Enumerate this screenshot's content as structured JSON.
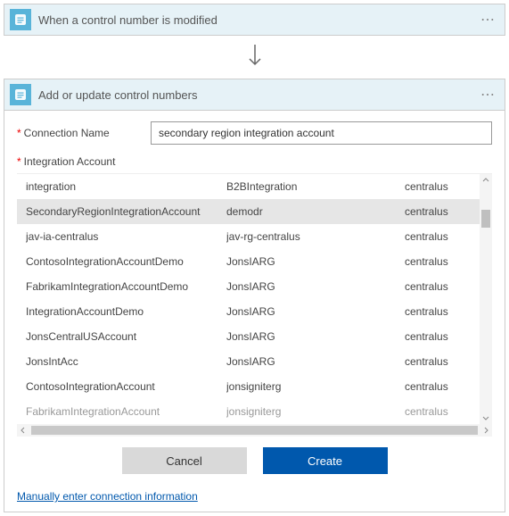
{
  "trigger": {
    "title": "When a control number is modified"
  },
  "action": {
    "title": "Add or update control numbers",
    "form": {
      "connection_name_label": "Connection Name",
      "connection_name_value": "secondary region integration account",
      "integration_account_label": "Integration Account"
    },
    "accounts": [
      {
        "name": "integration",
        "group": "B2BIntegration",
        "region": "centralus",
        "selected": false
      },
      {
        "name": "SecondaryRegionIntegrationAccount",
        "group": "demodr",
        "region": "centralus",
        "selected": true
      },
      {
        "name": "jav-ia-centralus",
        "group": "jav-rg-centralus",
        "region": "centralus",
        "selected": false
      },
      {
        "name": "ContosoIntegrationAccountDemo",
        "group": "JonsIARG",
        "region": "centralus",
        "selected": false
      },
      {
        "name": "FabrikamIntegrationAccountDemo",
        "group": "JonsIARG",
        "region": "centralus",
        "selected": false
      },
      {
        "name": "IntegrationAccountDemo",
        "group": "JonsIARG",
        "region": "centralus",
        "selected": false
      },
      {
        "name": "JonsCentralUSAccount",
        "group": "JonsIARG",
        "region": "centralus",
        "selected": false
      },
      {
        "name": "JonsIntAcc",
        "group": "JonsIARG",
        "region": "centralus",
        "selected": false
      },
      {
        "name": "ContosoIntegrationAccount",
        "group": "jonsigniterg",
        "region": "centralus",
        "selected": false
      },
      {
        "name": "FabrikamIntegrationAccount",
        "group": "jonsigniterg",
        "region": "centralus",
        "selected": false,
        "faded": true
      }
    ],
    "buttons": {
      "cancel": "Cancel",
      "create": "Create"
    },
    "manual_link": "Manually enter connection information"
  }
}
